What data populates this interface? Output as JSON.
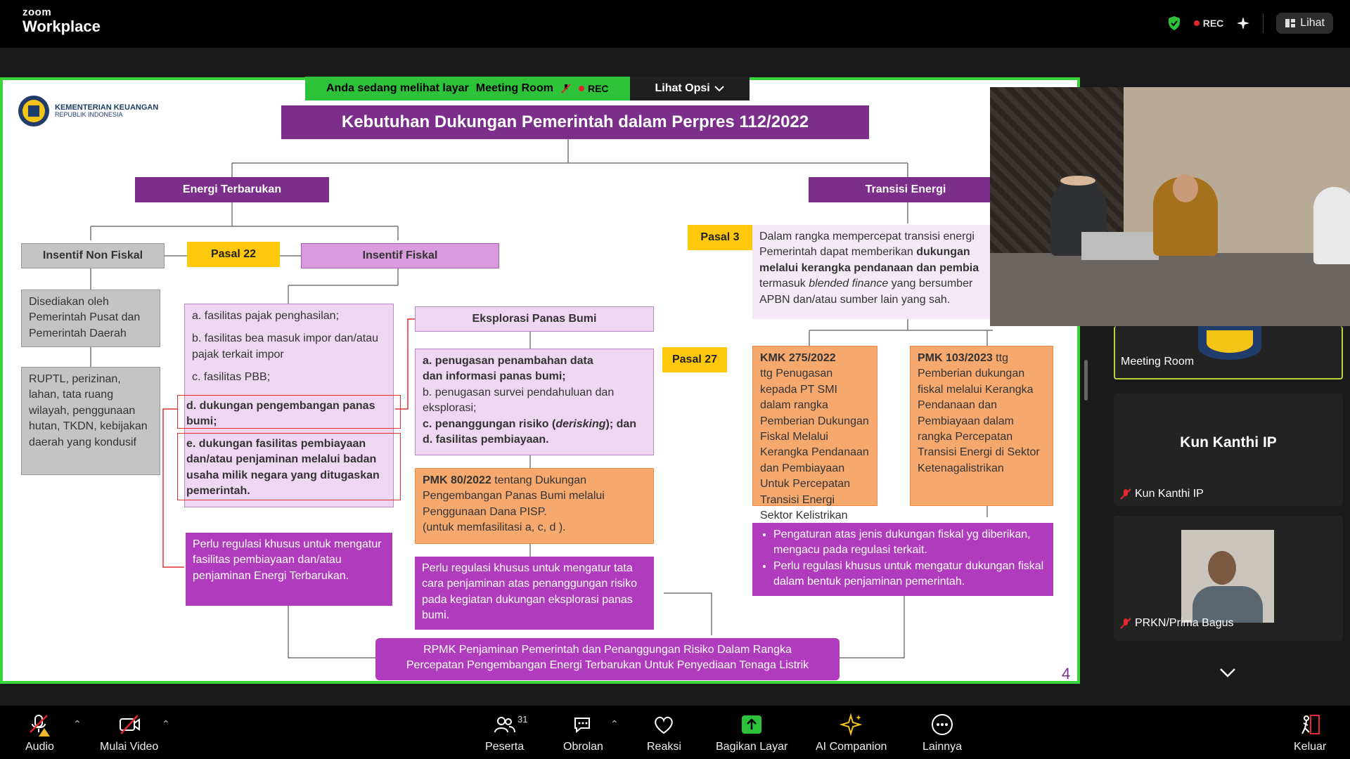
{
  "app": {
    "logo_line1": "zoom",
    "logo_line2": "Workplace"
  },
  "topbar": {
    "rec_label": "REC",
    "view_button": "Lihat"
  },
  "banner": {
    "viewing_text": "Anda sedang melihat layar",
    "room_name": "Meeting Room",
    "rec_label": "REC",
    "options_button": "Lihat Opsi"
  },
  "slide": {
    "org_line1": "KEMENTERIAN KEUANGAN",
    "org_line2": "REPUBLIK INDONESIA",
    "title": "Kebutuhan Dukungan Pemerintah dalam Perpres 112/2022",
    "energi_terbarukan": "Energi Terbarukan",
    "transisi_energi": "Transisi Energi",
    "insentif_non_fiskal": "Insentif Non Fiskal",
    "pasal22": "Pasal 22",
    "insentif_fiskal": "Insentif Fiskal",
    "pasal3": "Pasal 3",
    "pasal3_text": {
      "t1": "Dalam rangka mempercepat transisi energi",
      "t2": "Pemerintah dapat memberikan ",
      "t2b": "dukungan",
      "t3b": "melalui kerangka pendanaan dan pembia",
      "t4": "termasuk ",
      "t4i": "blended finance",
      "t4c": " yang bersumber",
      "t5": "APBN dan/atau sumber lain yang sah."
    },
    "disediakan": "Disediakan oleh Pemerintah Pusat dan Pemerintah Daerah",
    "ruptl": "RUPTL, perizinan, lahan, tata ruang wilayah, penggunaan hutan, TKDN, kebijakan daerah yang kondusif",
    "fasilitas": {
      "a": "a. fasilitas pajak penghasilan;",
      "b": "b. fasilitas bea masuk impor dan/atau pajak terkait impor",
      "c": "c. fasilitas PBB;",
      "d": "d. dukungan pengembangan panas bumi;",
      "e": "e. dukungan fasilitas pembiayaan dan/atau penjaminan melalui badan usaha milik negara yang ditugaskan pemerintah."
    },
    "eksplorasi": "Eksplorasi Panas Bumi",
    "pasal27": "Pasal 27",
    "eksplorasi_items": {
      "a": "a. penugasan penambahan data dan informasi panas bumi;",
      "b": "b. penugasan survei pendahuluan dan eksplorasi;",
      "c1": "c. penanggungan risiko (",
      "c2": "derisking",
      "c3": "); dan",
      "d": "d. fasilitas pembiayaan."
    },
    "pmk80": {
      "bold": "PMK 80/2022",
      "text": " tentang Dukungan Pengembangan Panas Bumi melalui Penggunaan Dana PISP.",
      "note": "(untuk memfasilitasi a, c, d )."
    },
    "kmk275": {
      "bold": "KMK  275/2022",
      "text": "ttg Penugasan kepada PT SMI dalam rangka Pemberian Dukungan Fiskal Melalui Kerangka Pendanaan dan Pembiayaan Untuk Percepatan Transisi Energi Sektor Kelistrikan"
    },
    "pmk103": {
      "bold": "PMK 103/2023",
      "text": " ttg Pemberian dukungan fiskal melalui Kerangka Pendanaan dan Pembiayaan dalam rangka Percepatan Transisi Energi di Sektor Ketenagalistrikan"
    },
    "regulasi_et": "Perlu regulasi khusus untuk mengatur fasilitas pembiayaan dan/atau penjaminan Energi Terbarukan.",
    "regulasi_pb": "Perlu regulasi khusus untuk mengatur tata cara penjaminan atas penanggungan risiko pada kegiatan dukungan eksplorasi panas bumi.",
    "bullets": [
      "Pengaturan atas jenis dukungan fiskal yg diberikan,  mengacu pada regulasi terkait.",
      "Perlu regulasi khusus untuk mengatur dukungan fiskal dalam bentuk penjaminan pemerintah."
    ],
    "rpmk": "RPMK Penjaminan Pemerintah dan Penanggungan Risiko Dalam Rangka Percepatan Pengembangan Energi Terbarukan Untuk Penyediaan Tenaga Listrik",
    "page_number": "4"
  },
  "participants": {
    "meeting_room_label": "Meeting Room",
    "active_name": "Kun Kanthi IP",
    "tile1_label": "Kun Kanthi IP",
    "tile2_label": "PRKN/Prima Bagus"
  },
  "toolbar": {
    "audio": "Audio",
    "video": "Mulai Video",
    "participants": "Peserta",
    "participants_count": "31",
    "chat": "Obrolan",
    "reactions": "Reaksi",
    "share": "Bagikan Layar",
    "ai": "AI Companion",
    "more": "Lainnya",
    "leave": "Keluar"
  },
  "colors": {
    "accent_green": "#2ec13a",
    "slide_purple": "#7b2e8a",
    "pasal_yellow": "#ffc80a",
    "rec_red": "#e5262e"
  }
}
